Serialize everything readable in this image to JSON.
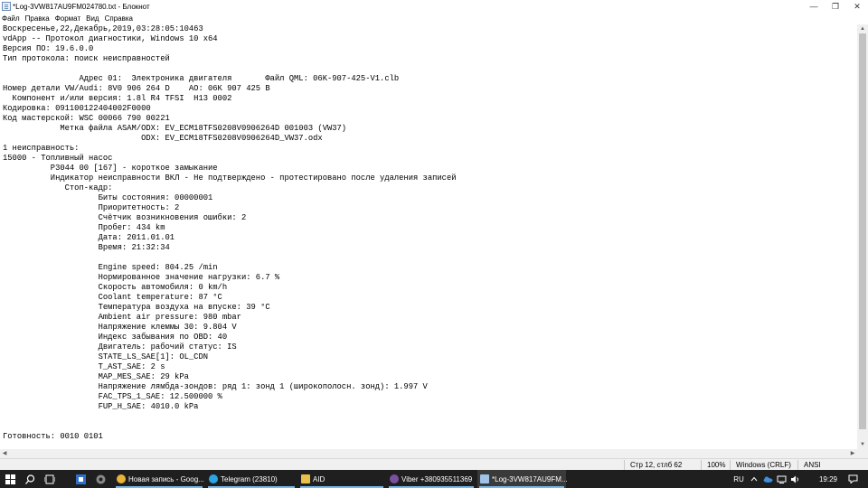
{
  "window": {
    "title": "*Log-3VW817AU9FM024780.txt - Блокнот",
    "controls": {
      "minimize": "—",
      "maximize": "❐",
      "close": "✕"
    }
  },
  "menu": [
    "Файл",
    "Правка",
    "Формат",
    "Вид",
    "Справка"
  ],
  "editor": {
    "lines": [
      "Воскресенье,22,Декабрь,2019,03:28:05:10463",
      "vdApp -- Протокол диагностики, Windows 10 x64",
      "Версия ПО: 19.6.0.0",
      "Тип протокола: поиск неисправностей",
      "",
      "                Адрес 01:  Электроника двигателя       Файл QML: 06K-907-425-V1.clb",
      "Номер детали VW/Audi: 8V0 906 264 D    AO: 06K 907 425 B",
      "  Компонент и/или версия: 1.8l R4 TFSI  H13 0002",
      "Кодировка: 091100122404002F0000",
      "Код мастерской: WSC 00066 790 00221",
      "            Метка файла ASAM/ODX: EV_ECM18TFS0208V0906264D 001003 (VW37)",
      "                             ODX: EV_ECM18TFS0208V0906264D_VW37.odx",
      "1 неисправность:",
      "15000 - Топливный насос",
      "          P3044 00 [167] - короткое замыкание",
      "          Индикатор неисправности ВКЛ - Не подтверждено - протестировано после удаления записей",
      "             Стоп-кадр:",
      "                    Биты состояния: 00000001",
      "                    Приоритетность: 2",
      "                    Счётчик возникновения ошибки: 2",
      "                    Пробег: 434 km",
      "                    Дата: 2011.01.01",
      "                    Время: 21:32:34",
      "",
      "                    Engine speed: 804.25 /min",
      "                    Нормированное значение нагрузки: 6.7 %",
      "                    Скорость автомобиля: 0 km/h",
      "                    Coolant temperature: 87 °C",
      "                    Температура воздуха на впуске: 39 °C",
      "                    Ambient air pressure: 980 mbar",
      "                    Напряжение клеммы 30: 9.804 V",
      "                    Индекс забывания по OBD: 40",
      "                    Двигатель: рабочий статус: IS",
      "                    STATE_LS_SAE[1]: OL_CDN",
      "                    T_AST_SAE: 2 s",
      "                    MAP_MES_SAE: 29 kPa",
      "                    Напряжение лямбда-зондов: ряд 1: зонд 1 (широкополосн. зонд): 1.997 V",
      "                    FAC_TPS_1_SAE: 12.500000 %",
      "                    FUP_H_SAE: 4010.0 kPa",
      "",
      "",
      "Готовность: 0010 0101"
    ]
  },
  "statusbar": {
    "position": "Стр 12, стлб 62",
    "zoom": "100%",
    "line_endings": "Windows (CRLF)",
    "encoding": "ANSI"
  },
  "taskbar": {
    "apps": [
      {
        "label": "Новая запись - Goog...",
        "icon": "chrome-icon",
        "color": "#e8b339"
      },
      {
        "label": "Telegram (23810)",
        "icon": "telegram-icon",
        "color": "#2ca5e0"
      },
      {
        "label": "AID",
        "icon": "folder-icon",
        "color": "#e8c04a"
      },
      {
        "label": "Viber +380935511369",
        "icon": "viber-icon",
        "color": "#7b519d"
      },
      {
        "label": "*Log-3VW817AU9FM...",
        "icon": "notepad-icon",
        "color": "#9ec3e6"
      }
    ],
    "tray": {
      "language": "RU",
      "time": "19:29"
    }
  },
  "colors": {
    "taskbar_bg": "#1f1f1f",
    "accent": "#76b9ed",
    "scrollbar_thumb": "#c2c2c2"
  }
}
